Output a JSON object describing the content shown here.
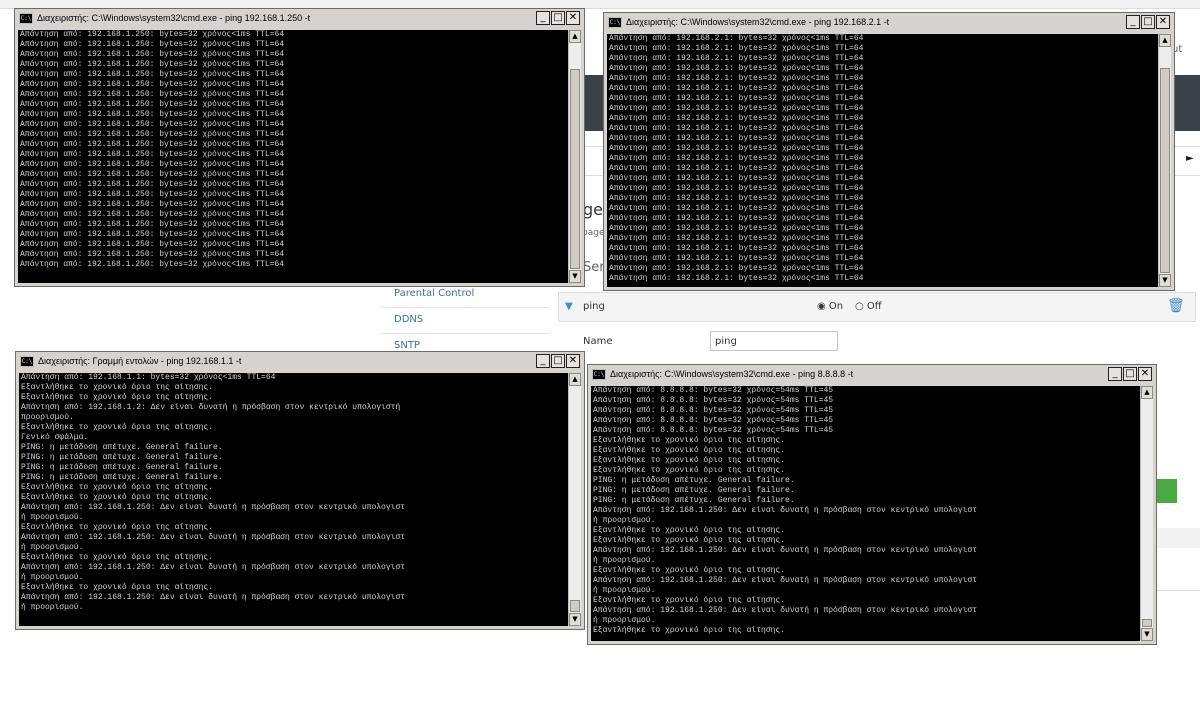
{
  "background_page": {
    "logout_fragment": "ut",
    "tab_arrow": "►",
    "heading_fragment": "ge",
    "heading_sub_fragment": "page",
    "section_fragment": "Ser",
    "sidebar": [
      "Parental Control",
      "DDNS",
      "SNTP"
    ],
    "service": {
      "title": "ping",
      "on_label": "On",
      "off_label": "Off",
      "name_label": "Name",
      "name_value": "ping"
    },
    "colors": {
      "nav_band": "#3a4248",
      "apply_button": "#49a942",
      "link": "#3f6fa3"
    }
  },
  "windows": [
    {
      "title": "Διαχειριστής: C:\\Windows\\system32\\cmd.exe - ping  192.168.1.250 -t",
      "lines": [
        "Απάντηση από: 192.168.1.250: bytes=32 χρόνος<1ms TTL=64",
        "Απάντηση από: 192.168.1.250: bytes=32 χρόνος<1ms TTL=64",
        "Απάντηση από: 192.168.1.250: bytes=32 χρόνος<1ms TTL=64",
        "Απάντηση από: 192.168.1.250: bytes=32 χρόνος<1ms TTL=64",
        "Απάντηση από: 192.168.1.250: bytes=32 χρόνος<1ms TTL=64",
        "Απάντηση από: 192.168.1.250: bytes=32 χρόνος<1ms TTL=64",
        "Απάντηση από: 192.168.1.250: bytes=32 χρόνος<1ms TTL=64",
        "Απάντηση από: 192.168.1.250: bytes=32 χρόνος<1ms TTL=64",
        "Απάντηση από: 192.168.1.250: bytes=32 χρόνος<1ms TTL=64",
        "Απάντηση από: 192.168.1.250: bytes=32 χρόνος<1ms TTL=64",
        "Απάντηση από: 192.168.1.250: bytes=32 χρόνος<1ms TTL=64",
        "Απάντηση από: 192.168.1.250: bytes=32 χρόνος<1ms TTL=64",
        "Απάντηση από: 192.168.1.250: bytes=32 χρόνος<1ms TTL=64",
        "Απάντηση από: 192.168.1.250: bytes=32 χρόνος<1ms TTL=64",
        "Απάντηση από: 192.168.1.250: bytes=32 χρόνος<1ms TTL=64",
        "Απάντηση από: 192.168.1.250: bytes=32 χρόνος<1ms TTL=64",
        "Απάντηση από: 192.168.1.250: bytes=32 χρόνος<1ms TTL=64",
        "Απάντηση από: 192.168.1.250: bytes=32 χρόνος<1ms TTL=64",
        "Απάντηση από: 192.168.1.250: bytes=32 χρόνος<1ms TTL=64",
        "Απάντηση από: 192.168.1.250: bytes=32 χρόνος<1ms TTL=64",
        "Απάντηση από: 192.168.1.250: bytes=32 χρόνος<1ms TTL=64",
        "Απάντηση από: 192.168.1.250: bytes=32 χρόνος<1ms TTL=64",
        "Απάντηση από: 192.168.1.250: bytes=32 χρόνος<1ms TTL=64",
        "Απάντηση από: 192.168.1.250: bytes=32 χρόνος<1ms TTL=64"
      ]
    },
    {
      "title": "Διαχειριστής: C:\\Windows\\system32\\cmd.exe - ping  192.168.2.1 -t",
      "lines": [
        "Απάντηση από: 192.168.2.1: bytes=32 χρόνος<1ms TTL=64",
        "Απάντηση από: 192.168.2.1: bytes=32 χρόνος<1ms TTL=64",
        "Απάντηση από: 192.168.2.1: bytes=32 χρόνος<1ms TTL=64",
        "Απάντηση από: 192.168.2.1: bytes=32 χρόνος<1ms TTL=64",
        "Απάντηση από: 192.168.2.1: bytes=32 χρόνος<1ms TTL=64",
        "Απάντηση από: 192.168.2.1: bytes=32 χρόνος<1ms TTL=64",
        "Απάντηση από: 192.168.2.1: bytes=32 χρόνος<1ms TTL=64",
        "Απάντηση από: 192.168.2.1: bytes=32 χρόνος<1ms TTL=64",
        "Απάντηση από: 192.168.2.1: bytes=32 χρόνος<1ms TTL=64",
        "Απάντηση από: 192.168.2.1: bytes=32 χρόνος<1ms TTL=64",
        "Απάντηση από: 192.168.2.1: bytes=32 χρόνος<1ms TTL=64",
        "Απάντηση από: 192.168.2.1: bytes=32 χρόνος<1ms TTL=64",
        "Απάντηση από: 192.168.2.1: bytes=32 χρόνος<1ms TTL=64",
        "Απάντηση από: 192.168.2.1: bytes=32 χρόνος<1ms TTL=64",
        "Απάντηση από: 192.168.2.1: bytes=32 χρόνος<1ms TTL=64",
        "Απάντηση από: 192.168.2.1: bytes=32 χρόνος<1ms TTL=64",
        "Απάντηση από: 192.168.2.1: bytes=32 χρόνος<1ms TTL=64",
        "Απάντηση από: 192.168.2.1: bytes=32 χρόνος<1ms TTL=64",
        "Απάντηση από: 192.168.2.1: bytes=32 χρόνος<1ms TTL=64",
        "Απάντηση από: 192.168.2.1: bytes=32 χρόνος<1ms TTL=64",
        "Απάντηση από: 192.168.2.1: bytes=32 χρόνος<1ms TTL=64",
        "Απάντηση από: 192.168.2.1: bytes=32 χρόνος<1ms TTL=64",
        "Απάντηση από: 192.168.2.1: bytes=32 χρόνος<1ms TTL=64",
        "Απάντηση από: 192.168.2.1: bytes=32 χρόνος<1ms TTL=64",
        "Απάντηση από: 192.168.2.1: bytes=32 χρόνος<1ms TTL=64"
      ]
    },
    {
      "title": "Διαχειριστής: Γραμμή εντολών - ping  192.168.1.1 -t",
      "lines": [
        "Απάντηση από: 192.168.1.1: bytes=32 χρόνος<1ms TTL=64",
        "Εξαντλήθηκε το χρονικό όριο της αίτησης.",
        "Εξαντλήθηκε το χρονικό όριο της αίτησης.",
        "Απάντηση από: 192.168.1.2: Δεν είναι δυνατή η πρόσβαση στον κεντρικό υπολογιστή",
        "προορισμού.",
        "Εξαντλήθηκε το χρονικό όριο της αίτησης.",
        "Γενικό σφάλμα.",
        "PING: η μετάδοση απέτυχε. General failure.",
        "PING: η μετάδοση απέτυχε. General failure.",
        "PING: η μετάδοση απέτυχε. General failure.",
        "PING: η μετάδοση απέτυχε. General failure.",
        "Εξαντλήθηκε το χρονικό όριο της αίτησης.",
        "Εξαντλήθηκε το χρονικό όριο της αίτησης.",
        "Απάντηση από: 192.168.1.250: Δεν είναι δυνατή η πρόσβαση στον κεντρικό υπολογιστ",
        "ή προορισμού.",
        "Εξαντλήθηκε το χρονικό όριο της αίτησης.",
        "Απάντηση από: 192.168.1.250: Δεν είναι δυνατή η πρόσβαση στον κεντρικό υπολογιστ",
        "ή προορισμού.",
        "Εξαντλήθηκε το χρονικό όριο της αίτησης.",
        "Απάντηση από: 192.168.1.250: Δεν είναι δυνατή η πρόσβαση στον κεντρικό υπολογιστ",
        "ή προορισμού.",
        "Εξαντλήθηκε το χρονικό όριο της αίτησης.",
        "Απάντηση από: 192.168.1.250: Δεν είναι δυνατή η πρόσβαση στον κεντρικό υπολογιστ",
        "ή προορισμού."
      ]
    },
    {
      "title": "Διαχειριστής: C:\\Windows\\system32\\cmd.exe - ping  8.8.8.8 -t",
      "lines": [
        "Απάντηση από: 8.8.8.8: bytes=32 χρόνος=54ms TTL=45",
        "Απάντηση από: 8.8.8.8: bytes=32 χρόνος=54ms TTL=45",
        "Απάντηση από: 8.8.8.8: bytes=32 χρόνος=54ms TTL=45",
        "Απάντηση από: 8.8.8.8: bytes=32 χρόνος=54ms TTL=45",
        "Απάντηση από: 8.8.8.8: bytes=32 χρόνος=54ms TTL=45",
        "Εξαντλήθηκε το χρονικό όριο της αίτησης.",
        "Εξαντλήθηκε το χρονικό όριο της αίτησης.",
        "Εξαντλήθηκε το χρονικό όριο της αίτησης.",
        "Εξαντλήθηκε το χρονικό όριο της αίτησης.",
        "PING: η μετάδοση απέτυχε. General failure.",
        "PING: η μετάδοση απέτυχε. General failure.",
        "PING: η μετάδοση απέτυχε. General failure.",
        "Απάντηση από: 192.168.1.250: Δεν είναι δυνατή η πρόσβαση στον κεντρικό υπολογιστ",
        "ή προορισμού.",
        "Εξαντλήθηκε το χρονικό όριο της αίτησης.",
        "Εξαντλήθηκε το χρονικό όριο της αίτησης.",
        "Απάντηση από: 192.168.1.250: Δεν είναι δυνατή η πρόσβαση στον κεντρικό υπολογιστ",
        "ή προορισμού.",
        "Εξαντλήθηκε το χρονικό όριο της αίτησης.",
        "Απάντηση από: 192.168.1.250: Δεν είναι δυνατή η πρόσβαση στον κεντρικό υπολογιστ",
        "ή προορισμού.",
        "Εξαντλήθηκε το χρονικό όριο της αίτησης.",
        "Απάντηση από: 192.168.1.250: Δεν είναι δυνατή η πρόσβαση στον κεντρικό υπολογιστ",
        "ή προορισμού.",
        "Εξαντλήθηκε το χρονικό όριο της αίτησης."
      ]
    }
  ]
}
